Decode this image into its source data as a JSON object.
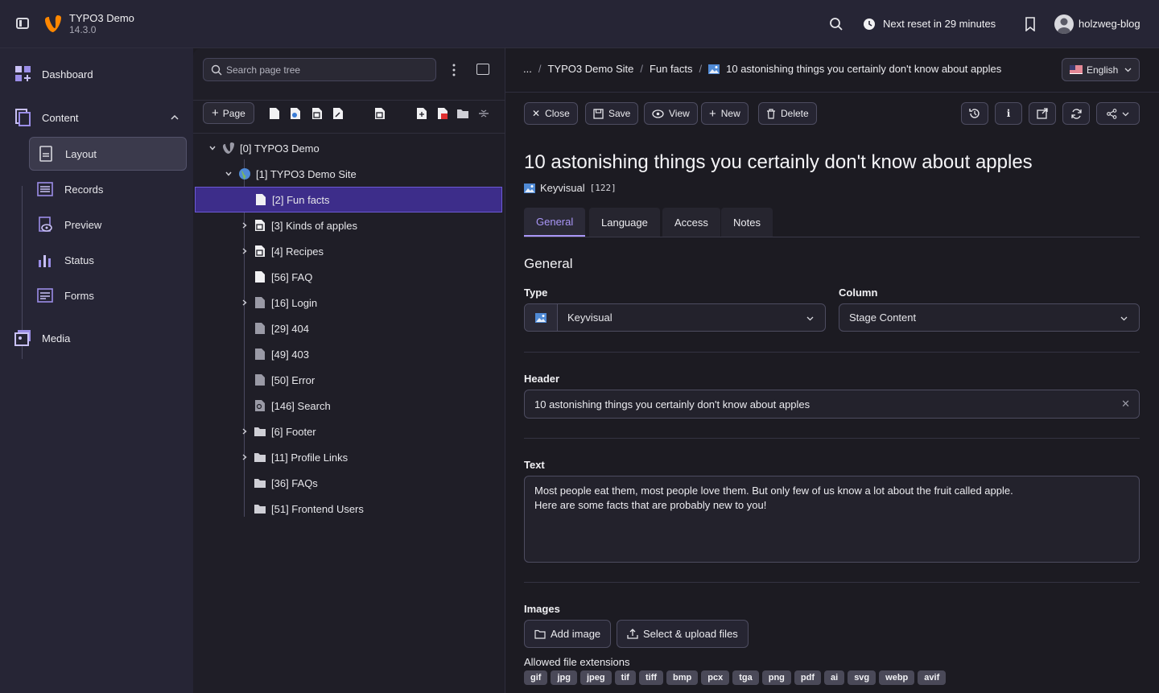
{
  "topbar": {
    "brand_name": "TYPO3 Demo",
    "brand_version": "14.3.0",
    "reset_text": "Next reset in 29 minutes",
    "username": "holzweg-blog"
  },
  "modules": {
    "dashboard": "Dashboard",
    "content": "Content",
    "submodules": [
      "Layout",
      "Records",
      "Preview",
      "Status",
      "Forms"
    ],
    "media": "Media"
  },
  "tree": {
    "search_placeholder": "Search page tree",
    "page_button": "Page",
    "nodes": [
      {
        "label": "[0] TYPO3 Demo"
      },
      {
        "label": "[1] TYPO3 Demo Site"
      },
      {
        "label": "[2] Fun facts"
      },
      {
        "label": "[3] Kinds of apples"
      },
      {
        "label": "[4] Recipes"
      },
      {
        "label": "[56] FAQ"
      },
      {
        "label": "[16] Login"
      },
      {
        "label": "[29] 404"
      },
      {
        "label": "[49] 403"
      },
      {
        "label": "[50] Error"
      },
      {
        "label": "[146] Search"
      },
      {
        "label": "[6] Footer"
      },
      {
        "label": "[11] Profile Links"
      },
      {
        "label": "[36] FAQs"
      },
      {
        "label": "[51] Frontend Users"
      }
    ]
  },
  "breadcrumb": {
    "ellipsis": "...",
    "items": [
      "TYPO3 Demo Site",
      "Fun facts",
      "10 astonishing things you certainly don't know about apples"
    ]
  },
  "language": "English",
  "actions": {
    "close": "Close",
    "save": "Save",
    "view": "View",
    "new": "New",
    "delete": "Delete"
  },
  "record": {
    "title": "10 astonishing things you certainly don't know about apples",
    "type_label": "Keyvisual",
    "uid": "[122]"
  },
  "tabs": [
    "General",
    "Language",
    "Access",
    "Notes"
  ],
  "form": {
    "section": "General",
    "type_label": "Type",
    "type_value": "Keyvisual",
    "column_label": "Column",
    "column_value": "Stage Content",
    "header_label": "Header",
    "header_value": "10 astonishing things you certainly don't know about apples",
    "text_label": "Text",
    "text_line1": "Most people eat them, most people love them. But only few of us know a lot about the fruit called apple.",
    "text_line2": "Here are some facts that are probably new to you!",
    "images_label": "Images",
    "add_image": "Add image",
    "select_upload": "Select & upload files",
    "allowed_label": "Allowed file extensions",
    "extensions": [
      "gif",
      "jpg",
      "jpeg",
      "tif",
      "tiff",
      "bmp",
      "pcx",
      "tga",
      "png",
      "pdf",
      "ai",
      "svg",
      "webp",
      "avif"
    ]
  },
  "colors": {
    "accent": "#a996f7",
    "selected_row": "#3d2d8a",
    "typo3_orange": "#ff8700"
  }
}
